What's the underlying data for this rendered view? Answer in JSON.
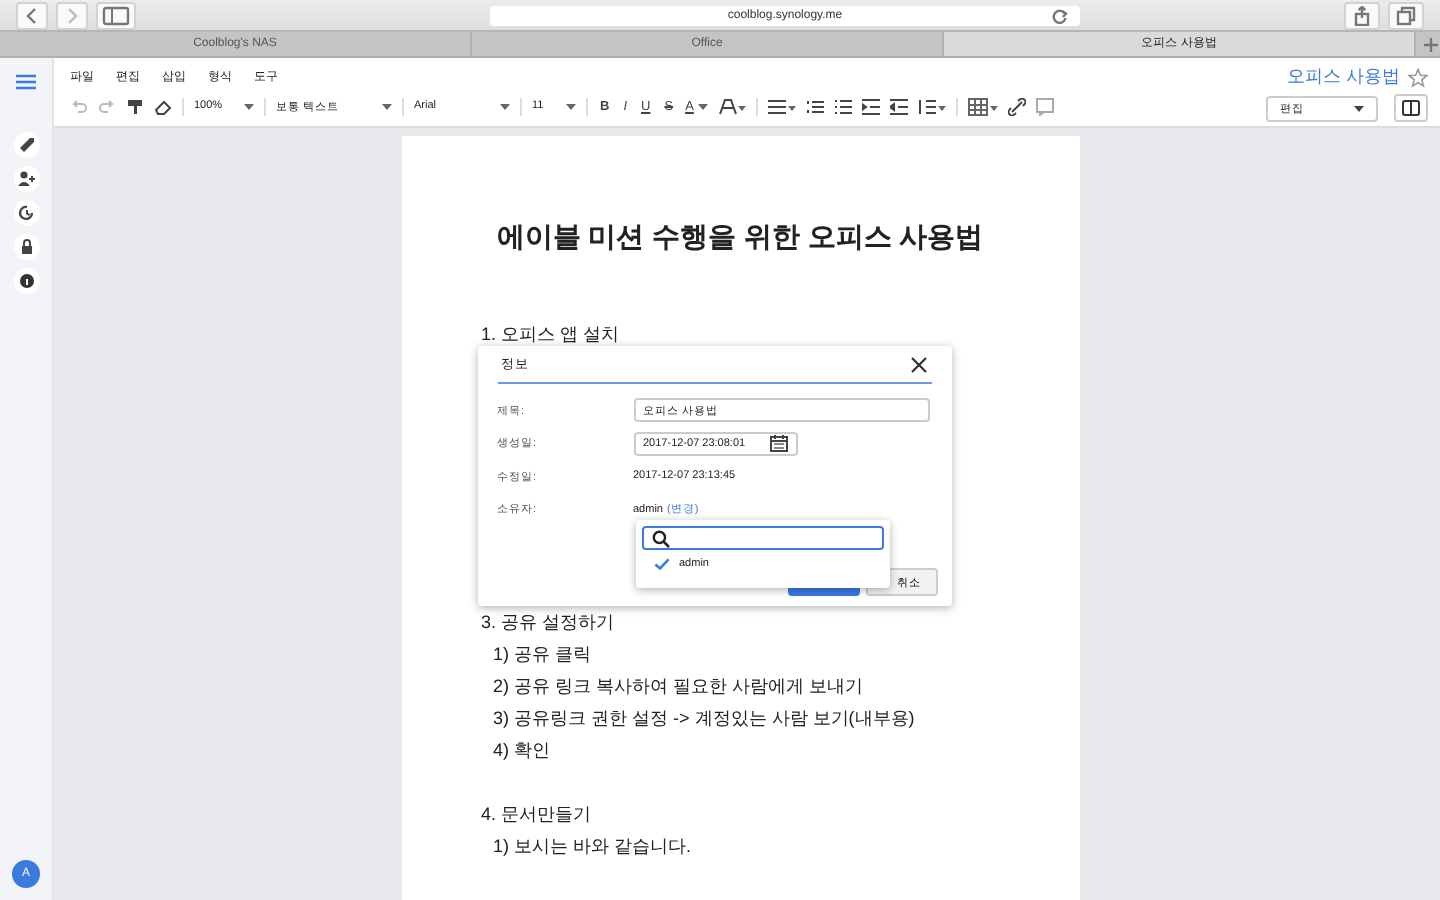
{
  "browser": {
    "address": "coolblog.synology.me",
    "tabs": [
      {
        "label": "Coolblog's NAS",
        "selected": false
      },
      {
        "label": "Office",
        "selected": false
      },
      {
        "label": "오피스 사용법",
        "selected": true
      }
    ]
  },
  "menu": [
    "파일",
    "편집",
    "삽입",
    "형식",
    "도구"
  ],
  "toolbar": {
    "zoom": "100%",
    "style": "보통 텍스트",
    "font": "Arial",
    "size": "11",
    "format_buttons": [
      "B",
      "I",
      "U",
      "S"
    ],
    "text_color": "A"
  },
  "header": {
    "doc_title": "오피스 사용법",
    "starred": false,
    "mode": "편집"
  },
  "avatar": "A",
  "document": {
    "title": "에이블 미션 수행을 위한 오피스 사용법",
    "sections": [
      {
        "heading": "1. 오피스 앱 설치"
      },
      {
        "heading": "3. 공유 설정하기",
        "items": [
          "1) 공유 클릭",
          "2) 공유 링크 복사하여 필요한 사람에게 보내기",
          "3) 공유링크 권한 설정 -> 계정있는 사람 보기(내부용)",
          "4) 확인"
        ]
      },
      {
        "heading": "4. 문서만들기",
        "items": [
          "1) 보시는 바와 같습니다."
        ]
      }
    ]
  },
  "dialog": {
    "title": "정보",
    "fields": [
      {
        "label": "제목:",
        "kind": "input",
        "value": "오피스 사용법"
      },
      {
        "label": "생성일:",
        "kind": "date",
        "value": "2017-12-07 23:08:01"
      },
      {
        "label": "수정일:",
        "kind": "text",
        "value": "2017-12-07 23:13:45"
      },
      {
        "label": "소유자:",
        "kind": "owner",
        "value": "admin",
        "link": "(변경)"
      }
    ],
    "cancel": "취소",
    "owner_dropdown": {
      "options": [
        {
          "label": "admin",
          "selected": true
        }
      ]
    }
  }
}
